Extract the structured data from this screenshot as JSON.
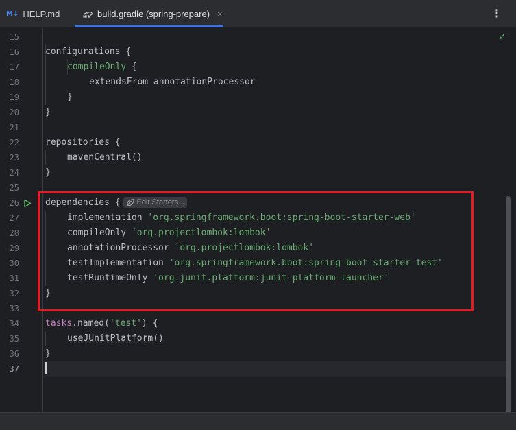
{
  "tabs": [
    {
      "icon": "markdown-icon",
      "icon_text": "M↓",
      "label": "HELP.md",
      "active": false
    },
    {
      "icon": "gradle-icon",
      "label": "build.gradle (spring-prepare)",
      "active": true,
      "close_glyph": "×"
    }
  ],
  "toolbar": {
    "more_glyph": "⋮",
    "inspection_glyph": "✓"
  },
  "hint": {
    "label": "Edit Starters..."
  },
  "lines": [
    {
      "n": "15",
      "text": ""
    },
    {
      "n": "16",
      "text": "configurations {"
    },
    {
      "n": "17",
      "text": "    compileOnly {"
    },
    {
      "n": "18",
      "text": "        extendsFrom annotationProcessor"
    },
    {
      "n": "19",
      "text": "    }"
    },
    {
      "n": "20",
      "text": "}"
    },
    {
      "n": "21",
      "text": ""
    },
    {
      "n": "22",
      "text": "repositories {"
    },
    {
      "n": "23",
      "text": "    mavenCentral()"
    },
    {
      "n": "24",
      "text": "}"
    },
    {
      "n": "25",
      "text": ""
    },
    {
      "n": "26",
      "text": "dependencies {"
    },
    {
      "n": "27",
      "text": "    implementation 'org.springframework.boot:spring-boot-starter-web'"
    },
    {
      "n": "28",
      "text": "    compileOnly 'org.projectlombok:lombok'"
    },
    {
      "n": "29",
      "text": "    annotationProcessor 'org.projectlombok:lombok'"
    },
    {
      "n": "30",
      "text": "    testImplementation 'org.springframework.boot:spring-boot-starter-test'"
    },
    {
      "n": "31",
      "text": "    testRuntimeOnly 'org.junit.platform:junit-platform-launcher'"
    },
    {
      "n": "32",
      "text": "}"
    },
    {
      "n": "33",
      "text": ""
    },
    {
      "n": "34",
      "text": "tasks.named('test') {"
    },
    {
      "n": "35",
      "text": "    useJUnitPlatform()"
    },
    {
      "n": "36",
      "text": "}"
    },
    {
      "n": "37",
      "text": ""
    }
  ],
  "tokens": {
    "l16": {
      "a": "configurations",
      "b": " {"
    },
    "l17": {
      "a": "compileOnly",
      "b": " {"
    },
    "l18": {
      "a": "extendsFrom annotationProcessor"
    },
    "l19": {
      "a": "}"
    },
    "l20": {
      "a": "}"
    },
    "l22": {
      "a": "repositories",
      "b": " {"
    },
    "l23": {
      "a": "mavenCentral()"
    },
    "l24": {
      "a": "}"
    },
    "l26": {
      "a": "dependencies",
      "b": " {"
    },
    "l27": {
      "a": "implementation",
      "b": "'org.springframework.boot:spring-boot-starter-web'"
    },
    "l28": {
      "a": "compileOnly",
      "b": "'org.projectlombok:lombok'"
    },
    "l29": {
      "a": "annotationProcessor",
      "b": "'org.projectlombok:lombok'"
    },
    "l30": {
      "a": "testImplementation",
      "b": "'org.springframework.boot:spring-boot-starter-test'"
    },
    "l31": {
      "a": "testRuntimeOnly",
      "b": "'org.junit.platform:junit-platform-launcher'"
    },
    "l32": {
      "a": "}"
    },
    "l34": {
      "a": "tasks",
      "b": ".named(",
      "c": "'test'",
      "d": ") {"
    },
    "l35": {
      "a": "useJUnitPlatform",
      "b": "()"
    },
    "l36": {
      "a": "}"
    }
  },
  "editor": {
    "current_line": "37",
    "highlighted_block": "dependencies"
  },
  "colors": {
    "accent": "#3574f0",
    "highlight_box": "#e41b23",
    "string": "#6aab73",
    "keyword": "#c77dbb"
  }
}
